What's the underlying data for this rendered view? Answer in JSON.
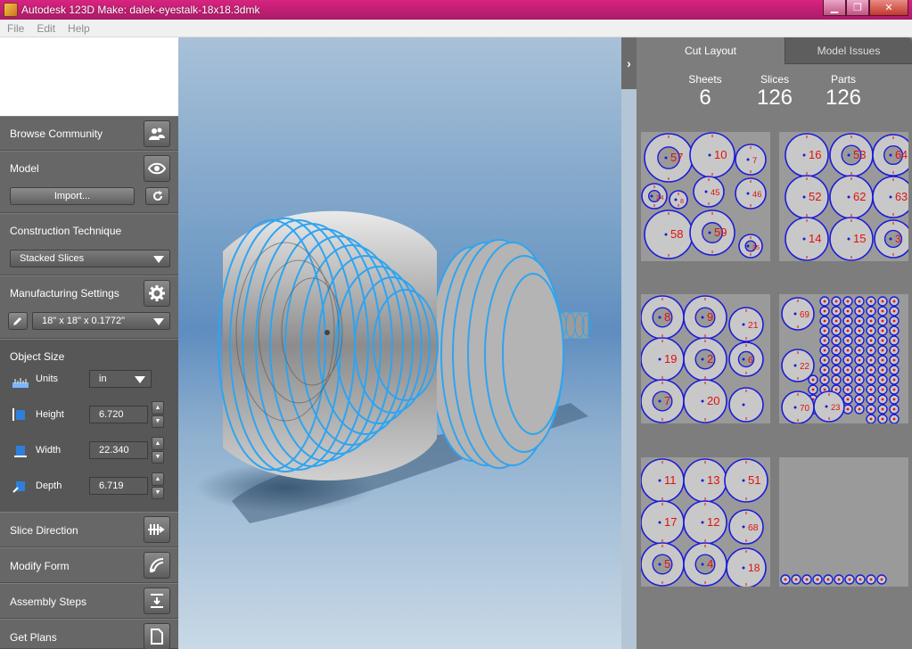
{
  "window": {
    "title": "Autodesk 123D Make: dalek-eyestalk-18x18.3dmk",
    "minimize": "▁",
    "maximize": "❐",
    "close": "✕"
  },
  "menu": [
    "File",
    "Edit",
    "Help"
  ],
  "left": {
    "browse_community": "Browse Community",
    "model": "Model",
    "import_label": "Import...",
    "construction_technique": "Construction Technique",
    "technique_value": "Stacked Slices",
    "manufacturing_settings": "Manufacturing Settings",
    "material_value": "18\" x 18\" x 0.1772\"",
    "object_size": "Object Size",
    "units_label": "Units",
    "units_value": "in",
    "height_label": "Height",
    "height_value": "6.720",
    "width_label": "Width",
    "width_value": "22.340",
    "depth_label": "Depth",
    "depth_value": "6.719",
    "slice_direction": "Slice Direction",
    "modify_form": "Modify Form",
    "assembly_steps": "Assembly Steps",
    "get_plans": "Get Plans"
  },
  "right": {
    "tab_cut_layout": "Cut Layout",
    "tab_model_issues": "Model Issues",
    "sheets_label": "Sheets",
    "sheets_value": "6",
    "slices_label": "Slices",
    "slices_value": "126",
    "parts_label": "Parts",
    "parts_value": "126",
    "sheet_labels": [
      [
        "57",
        "10",
        "7",
        "24",
        "8",
        "45",
        "46",
        "58",
        "59",
        "35"
      ],
      [
        "16",
        "53",
        "64",
        "52",
        "62",
        "63",
        "14",
        "15",
        "3"
      ],
      [
        "8",
        "9",
        "21",
        "19",
        "2",
        "6",
        "7",
        "20"
      ],
      [
        "69",
        "22",
        "70",
        "23"
      ],
      [
        "11",
        "13",
        "51",
        "17",
        "12",
        "68",
        "5",
        "4",
        "18"
      ],
      []
    ]
  },
  "colors": {
    "accent_title": "#c11f73",
    "panel": "#676767",
    "part_outline": "#1c1cd6",
    "part_label": "#e01010",
    "model_outline": "#2fa4f0"
  },
  "icons": {
    "community": "people-icon",
    "eye": "eye-icon",
    "refresh": "refresh-icon",
    "gear": "gear-icon",
    "pencil": "pencil-icon",
    "ruler": "ruler-icon",
    "slice": "slice-direction-icon",
    "modify": "modify-form-icon",
    "assembly": "assembly-icon",
    "plans": "plans-icon"
  }
}
